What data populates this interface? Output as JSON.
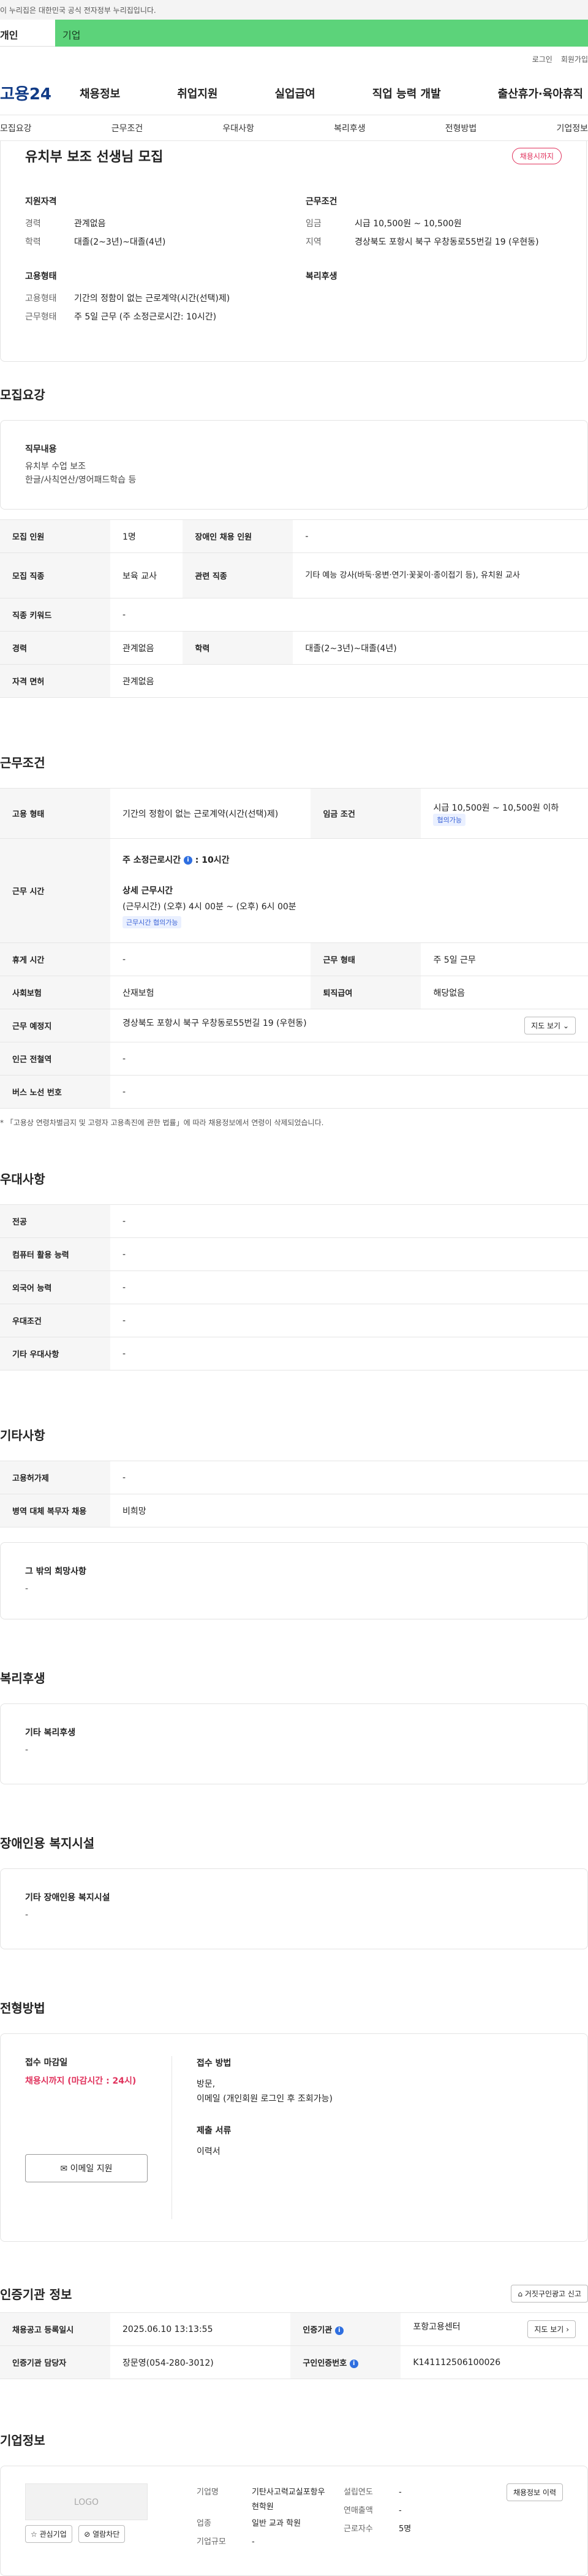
{
  "topbar": {
    "notice": "이 누리집은 대한민국 공식 전자정부 누리집입니다."
  },
  "tabs": {
    "personal": "개인",
    "company": "기업"
  },
  "util": {
    "login": "로그인",
    "join": "회원가입"
  },
  "gnb": {
    "logo": "고용24",
    "items": [
      "채용정보",
      "취업지원",
      "실업급여",
      "직업 능력 개발",
      "출산휴가·육아휴직"
    ]
  },
  "subtabs": [
    "모집요강",
    "근무조건",
    "우대사항",
    "복리후생",
    "전형방법",
    "기업정보"
  ],
  "job": {
    "title": "유치부 보조 선생님 모집",
    "badge": "채용시까지",
    "qual_h": "지원자격",
    "qual": [
      {
        "k": "경력",
        "v": "관계없음"
      },
      {
        "k": "학력",
        "v": "대졸(2~3년)~대졸(4년)"
      }
    ],
    "cond_h": "근무조건",
    "cond": [
      {
        "k": "임금",
        "v": "시급 10,500원 ~ 10,500원"
      },
      {
        "k": "지역",
        "v": "경상북도 포항시 북구 우창동로55번길 19 (우현동)"
      }
    ],
    "emp_h": "고용형태",
    "emp": [
      {
        "k": "고용형태",
        "v": "기간의 정함이 없는 근로계약(시간(선택)제)"
      },
      {
        "k": "근무형태",
        "v": "주 5일 근무 (주 소정근로시간: 10시간)"
      }
    ],
    "welfare_h": "복리후생"
  },
  "recruit": {
    "title": "모집요강",
    "duty_h": "직무내용",
    "duty_1": "유치부 수업 보조",
    "duty_2": "한글/사칙연산/영어패드학습 등",
    "rows": {
      "count_k": "모집 인원",
      "count_v": "1명",
      "disabled_k": "장애인 채용 인원",
      "disabled_v": "-",
      "job_k": "모집 직종",
      "job_v": "보육 교사",
      "rel_k": "관련 직종",
      "rel_v": "기타 예능 강사(바둑·웅변·연기·꽃꽂이·종이접기 등), 유치원 교사",
      "kw_k": "직종 키워드",
      "kw_v": "-",
      "career_k": "경력",
      "career_v": "관계없음",
      "edu_k": "학력",
      "edu_v": "대졸(2~3년)~대졸(4년)",
      "lic_k": "자격 면허",
      "lic_v": "관계없음"
    }
  },
  "work": {
    "title": "근무조건",
    "emp_k": "고용 형태",
    "emp_v": "기간의 정함이 없는 근로계약(시간(선택)제)",
    "wage_k": "임금 조건",
    "wage_v": "시급 10,500원 ~ 10,500원 이하",
    "wage_tag": "협의가능",
    "time_k": "근무 시간",
    "time_total": "주 소정근로시간",
    "time_total_v": ": 10시간",
    "time_detail_h": "상세 근무시간",
    "time_detail_v": "(근무시간) (오후) 4시 00분 ~ (오후) 6시 00분",
    "time_tag": "근무시간 협의가능",
    "rest_k": "휴게 시간",
    "rest_v": "-",
    "type_k": "근무 형태",
    "type_v": "주 5일 근무",
    "ins_k": "사회보험",
    "ins_v": "산재보험",
    "sev_k": "퇴직급여",
    "sev_v": "해당없음",
    "loc_k": "근무 예정지",
    "loc_v": "경상북도 포항시 북구 우창동로55번길 19 (우현동)",
    "map_btn": "지도 보기",
    "sub_k": "인근 전철역",
    "sub_v": "-",
    "bus_k": "버스 노선 번호",
    "bus_v": "-",
    "note": "* 「고용상 연령차별금지 및 고령자 고용촉진에 관한 법률」에 따라 채용정보에서 연령이 삭제되었습니다."
  },
  "pref": {
    "title": "우대사항",
    "rows": [
      {
        "k": "전공",
        "v": "-"
      },
      {
        "k": "컴퓨터 활용 능력",
        "v": "-"
      },
      {
        "k": "외국어 능력",
        "v": "-"
      },
      {
        "k": "우대조건",
        "v": "-"
      },
      {
        "k": "기타 우대사항",
        "v": "-"
      }
    ]
  },
  "etc": {
    "title": "기타사항",
    "rows": [
      {
        "k": "고용허가제",
        "v": "-"
      },
      {
        "k": "병역 대체 복무자 채용",
        "v": "비희망"
      }
    ],
    "other_h": "그 밖의 희망사항",
    "other_v": "-"
  },
  "welfare": {
    "title": "복리후생",
    "h": "기타 복리후생",
    "v": "-"
  },
  "facility": {
    "title": "장애인용 복지시설",
    "h": "기타 장애인용 복지시설",
    "v": "-"
  },
  "process": {
    "title": "전형방법",
    "deadline_h": "접수 마감일",
    "deadline_v": "채용시까지 (마감시간 : 24시)",
    "method_h": "접수 방법",
    "method_1": "방문,",
    "method_2": "이메일 (개인회원 로그인 후 조회가능)",
    "docs_h": "제출 서류",
    "docs_v": "이력서",
    "email_btn": "이메일 지원"
  },
  "cert": {
    "title": "인증기관 정보",
    "report_btn": "거짓구인광고 신고",
    "reg_k": "채용공고 등록일시",
    "reg_v": "2025.06.10 13:13:55",
    "org_k": "인증기관",
    "org_v": "포항고용센터",
    "map_btn": "지도 보기",
    "mgr_k": "인증기관 담당자",
    "mgr_v": "장문영(054-280-3012)",
    "num_k": "구인인증번호",
    "num_v": "K141112506100026"
  },
  "company": {
    "title": "기업정보",
    "logo": "LOGO",
    "fav_btn": "관심기업",
    "block_btn": "열람차단",
    "history_btn": "채용정보 이력",
    "name_k": "기업명",
    "name_v": "기탄사고력교실포항우현학원",
    "ind_k": "업종",
    "ind_v": "일반 교과 학원",
    "size_k": "기업규모",
    "size_v": "-",
    "year_k": "설립연도",
    "year_v": "-",
    "sales_k": "연매출액",
    "sales_v": "-",
    "emp_k": "근로자수",
    "emp_v": "5명"
  }
}
